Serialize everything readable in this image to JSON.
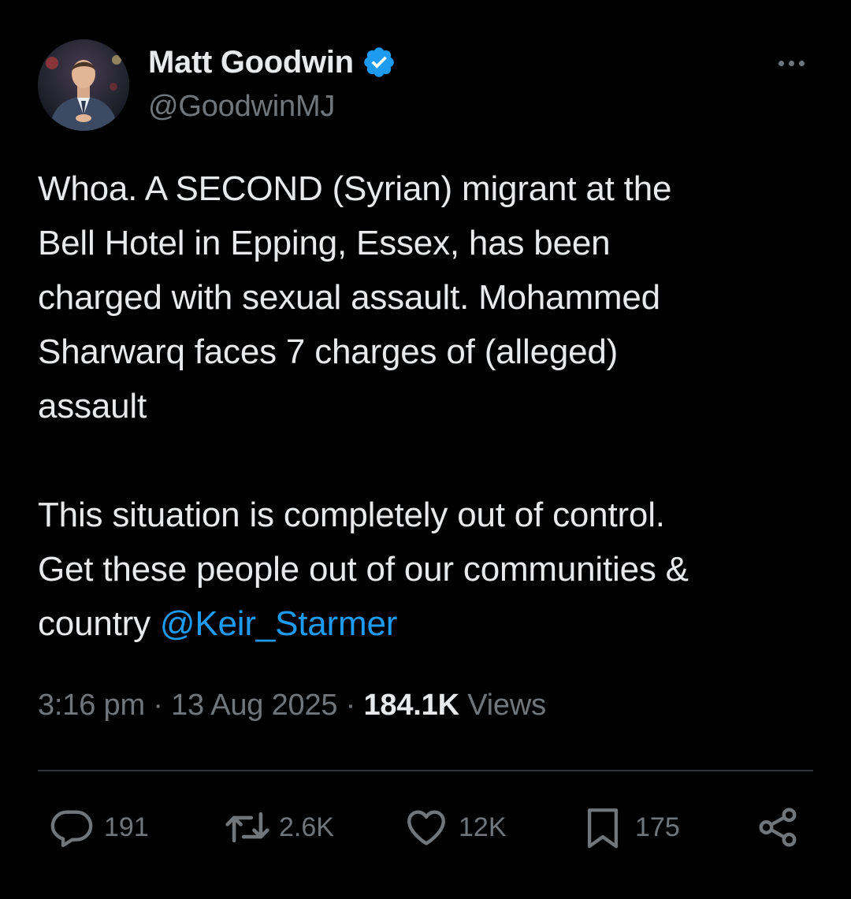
{
  "author": {
    "display_name": "Matt Goodwin",
    "handle": "@GoodwinMJ",
    "verified": true,
    "verified_color": "#1d9bf0"
  },
  "tweet": {
    "text_part1": "Whoa. A SECOND (Syrian) migrant at the\nBell Hotel in Epping, Essex, has been\ncharged with sexual assault. Mohammed\nSharwarq faces 7 charges of (alleged)\nassault\n\nThis situation is completely out of control.\nGet these people out of our communities &\ncountry ",
    "mention": "@Keir_Starmer",
    "mention_color": "#1d9bf0"
  },
  "meta": {
    "time": "3:16 pm",
    "separator": " · ",
    "date": "13 Aug 2025",
    "views_count": "184.1K",
    "views_label": " Views"
  },
  "actions": {
    "replies": {
      "icon": "reply-icon",
      "count": "191"
    },
    "reposts": {
      "icon": "repost-icon",
      "count": "2.6K"
    },
    "likes": {
      "icon": "heart-icon",
      "count": "12K"
    },
    "bookmarks": {
      "icon": "bookmark-icon",
      "count": "175"
    },
    "share": {
      "icon": "share-icon"
    }
  },
  "colors": {
    "background": "#000000",
    "text": "#e7e9ea",
    "secondary": "#71767b",
    "divider": "#2f3336"
  }
}
